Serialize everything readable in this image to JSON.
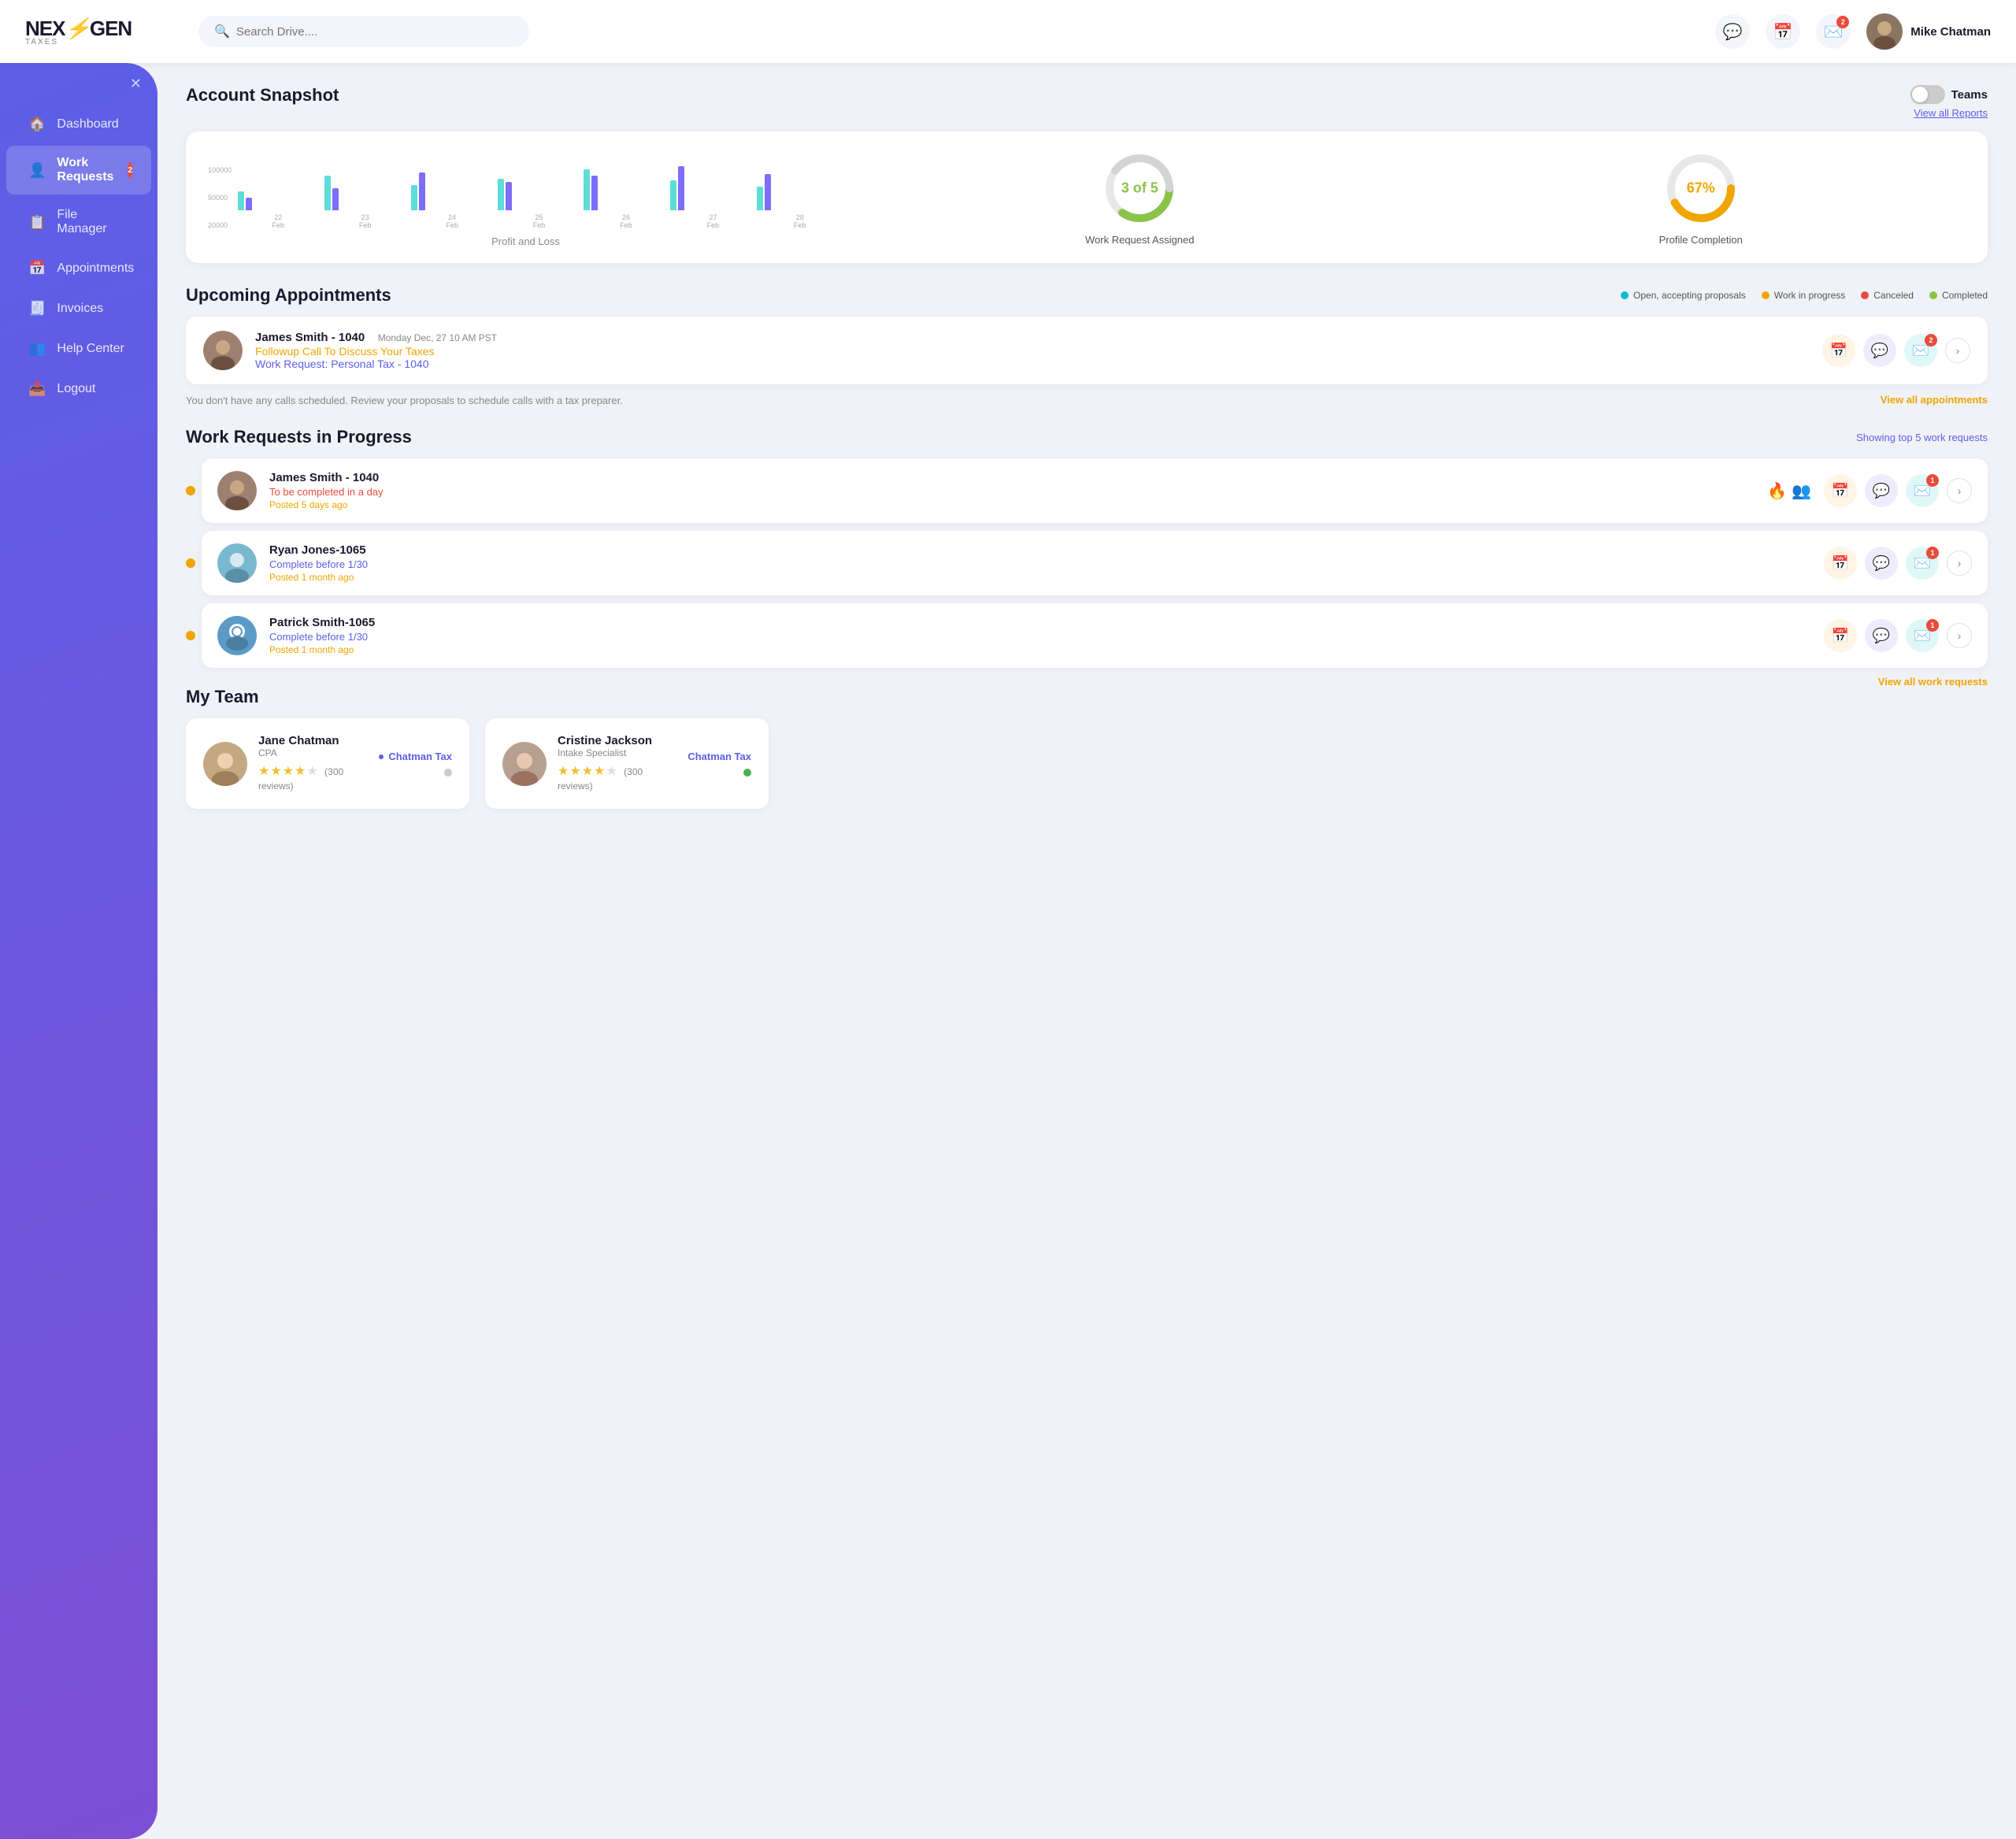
{
  "brand": {
    "name_part1": "NEX",
    "name_part2": "GEN",
    "tagline": "TAXES",
    "logo_icon": "⚡"
  },
  "topnav": {
    "search_placeholder": "Search Drive....",
    "user_name": "Mike Chatman",
    "notifications_badge": "2"
  },
  "sidebar": {
    "close_label": "×",
    "items": [
      {
        "id": "dashboard",
        "label": "Dashboard",
        "icon": "🏠",
        "badge": null,
        "active": false
      },
      {
        "id": "work-requests",
        "label": "Work Requests",
        "icon": "👤",
        "badge": "2",
        "active": true
      },
      {
        "id": "file-manager",
        "label": "File Manager",
        "icon": "📋",
        "badge": null,
        "active": false
      },
      {
        "id": "appointments",
        "label": "Appointments",
        "icon": "📅",
        "badge": null,
        "active": false
      },
      {
        "id": "invoices",
        "label": "Invoices",
        "icon": "🧾",
        "badge": null,
        "active": false
      },
      {
        "id": "help-center",
        "label": "Help Center",
        "icon": "👥",
        "badge": null,
        "active": false
      },
      {
        "id": "logout",
        "label": "Logout",
        "icon": "📤",
        "badge": null,
        "active": false
      }
    ]
  },
  "account_snapshot": {
    "title": "Account Snapshot",
    "teams_label": "Teams",
    "view_all_label": "View all Reports",
    "chart": {
      "title": "Profit and Loss",
      "y_labels": [
        "100000",
        "50000",
        "20000"
      ],
      "x_labels": [
        "22 Feb",
        "23 Feb",
        "24 Feb",
        "25 Feb",
        "26 Feb",
        "27 Feb",
        "28 Feb"
      ],
      "bars": [
        {
          "teal": 30,
          "purple": 20
        },
        {
          "teal": 55,
          "purple": 35
        },
        {
          "teal": 40,
          "purple": 60
        },
        {
          "teal": 50,
          "purple": 45
        },
        {
          "teal": 65,
          "purple": 55
        },
        {
          "teal": 48,
          "purple": 70
        },
        {
          "teal": 38,
          "purple": 58
        }
      ]
    },
    "work_request_assigned": {
      "label": "Work Request Assigned",
      "value": "3 of 5",
      "progress": 60,
      "color": "#8bc34a"
    },
    "profile_completion": {
      "label": "Profile Completion",
      "value": "67%",
      "progress": 67,
      "color": "#f0a500"
    }
  },
  "upcoming_appointments": {
    "title": "Upcoming Appointments",
    "legend": [
      {
        "label": "Open, accepting proposals",
        "color": "#00bcd4"
      },
      {
        "label": "Canceled",
        "color": "#e74c3c"
      },
      {
        "label": "Work in progress",
        "color": "#f0a500"
      },
      {
        "label": "Completed",
        "color": "#8bc34a"
      }
    ],
    "appointments": [
      {
        "name": "James Smith - 1040",
        "date": "Monday Dec, 27  10 AM PST",
        "link1": "Followup Call To Discuss Your Taxes",
        "link2": "Work Request: Personal Tax - 1040",
        "badge": "2"
      }
    ],
    "no_appt_msg": "You don't have any calls scheduled. Review your proposals to schedule calls with a tax preparer.",
    "view_all_label": "View all appointments"
  },
  "work_requests": {
    "title": "Work Requests in Progress",
    "showing_label": "Showing top 5 work requests",
    "view_all_label": "View all work requests",
    "items": [
      {
        "name": "James Smith - 1040",
        "due": "To be completed in a day",
        "due_color": "red",
        "posted": "Posted 5 days ago",
        "badge": "1",
        "has_fire": true,
        "has_team": true
      },
      {
        "name": "Ryan Jones-1065",
        "due": "Complete before 1/30",
        "due_color": "teal",
        "posted": "Posted 1 month ago",
        "badge": "1",
        "has_fire": false,
        "has_team": false
      },
      {
        "name": "Patrick Smith-1065",
        "due": "Complete before 1/30",
        "due_color": "teal",
        "posted": "Posted 1 month ago",
        "badge": "1",
        "has_fire": false,
        "has_team": false
      }
    ]
  },
  "my_team": {
    "title": "My Team",
    "members": [
      {
        "name": "Jane Chatman",
        "role": "CPA",
        "company": "Chatman Tax",
        "reviews": "300 reviews",
        "stars": 4,
        "status": "offline",
        "status_color": "#ccc"
      },
      {
        "name": "Cristine Jackson",
        "role": "Intake Specialist",
        "company": "Chatman Tax",
        "reviews": "300 reviews",
        "stars": 4,
        "status": "online",
        "status_color": "#4caf50"
      }
    ]
  }
}
